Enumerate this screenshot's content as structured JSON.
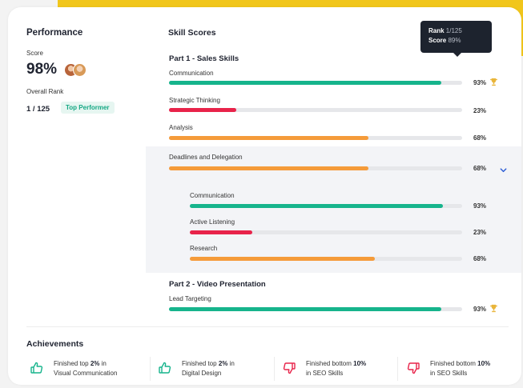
{
  "performance": {
    "title": "Performance",
    "score_label": "Score",
    "score_value": "98%",
    "rank_label": "Overall Rank",
    "rank_value": "1 / 125",
    "badge": "Top Performer"
  },
  "skills": {
    "title": "Skill Scores",
    "part1_title": "Part 1 - Sales Skills",
    "part2_title": "Part 2 - Video Presentation",
    "items": [
      {
        "label": "Communication",
        "percent": "93%",
        "value": 93,
        "color": "#16b48c"
      },
      {
        "label": "Strategic Thinking",
        "percent": "23%",
        "value": 23,
        "color": "#e8234a"
      },
      {
        "label": "Analysis",
        "percent": "68%",
        "value": 68,
        "color": "#f59b3a"
      },
      {
        "label": "Deadlines and Delegation",
        "percent": "68%",
        "value": 68,
        "color": "#f59b3a"
      },
      {
        "label": "Communication",
        "percent": "93%",
        "value": 93,
        "color": "#16b48c"
      },
      {
        "label": "Active Listening",
        "percent": "23%",
        "value": 23,
        "color": "#e8234a"
      },
      {
        "label": "Research",
        "percent": "68%",
        "value": 68,
        "color": "#f59b3a"
      },
      {
        "label": "Lead Targeting",
        "percent": "93%",
        "value": 93,
        "color": "#16b48c"
      }
    ]
  },
  "tooltip": {
    "rank_label": "Rank",
    "rank_value": "1/125",
    "score_label": "Score",
    "score_value": "89%"
  },
  "achievements": {
    "title": "Achievements",
    "items": [
      {
        "line1_pre": "Finished top ",
        "line1_bold": "2%",
        "line1_post": " in",
        "line2": "Visual Communication",
        "type": "positive"
      },
      {
        "line1_pre": "Finished top ",
        "line1_bold": "2%",
        "line1_post": " in",
        "line2": "Digital Design",
        "type": "positive"
      },
      {
        "line1_pre": "Finished bottom ",
        "line1_bold": "10%",
        "line1_post": "",
        "line2": "in SEO Skills",
        "type": "negative"
      },
      {
        "line1_pre": "Finished bottom ",
        "line1_bold": "10%",
        "line1_post": "",
        "line2": "in SEO Skills",
        "type": "negative"
      }
    ]
  },
  "colors": {
    "accent_yellow": "#f1c61b",
    "green": "#16b48c",
    "red": "#e8234a",
    "orange": "#f59b3a",
    "trophy": "#e9b53a"
  },
  "icons": {
    "trophy": "trophy-icon",
    "chevron": "chevron-down-icon",
    "thumbs_up": "thumbs-up-icon",
    "thumbs_down": "thumbs-down-icon"
  }
}
